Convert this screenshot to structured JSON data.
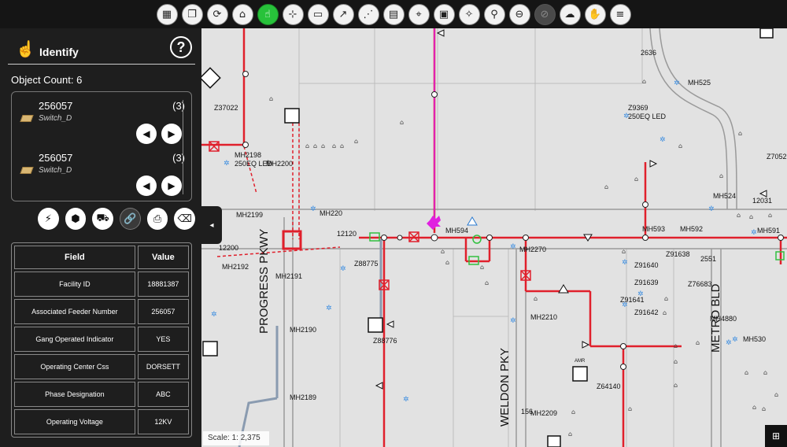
{
  "toolbar": {
    "buttons": [
      {
        "name": "map-layers-icon",
        "glyph": "▦"
      },
      {
        "name": "window-icon",
        "glyph": "❐"
      },
      {
        "name": "layers-refresh-icon",
        "glyph": "⟳"
      },
      {
        "name": "home-icon",
        "glyph": "⌂"
      },
      {
        "name": "identify-hand-icon",
        "glyph": "☝"
      },
      {
        "name": "select-features-icon",
        "glyph": "⊹"
      },
      {
        "name": "measure-icon",
        "glyph": "▭"
      },
      {
        "name": "trace-icon",
        "glyph": "↗"
      },
      {
        "name": "network-icon",
        "glyph": "⋰"
      },
      {
        "name": "book-icon",
        "glyph": "▤"
      },
      {
        "name": "coordinates-icon",
        "glyph": "⌖"
      },
      {
        "name": "print-icon",
        "glyph": "▣"
      },
      {
        "name": "compass-icon",
        "glyph": "✧"
      },
      {
        "name": "search-icon",
        "glyph": "⚲"
      },
      {
        "name": "zoom-out-icon",
        "glyph": "⊖"
      },
      {
        "name": "zoom-disabled-icon",
        "glyph": "⊘"
      },
      {
        "name": "cloud-download-icon",
        "glyph": "☁"
      },
      {
        "name": "pan-hand-icon",
        "glyph": "✋"
      },
      {
        "name": "menu-icon",
        "glyph": "≡"
      }
    ]
  },
  "panel": {
    "title": "Identify",
    "help": "?",
    "object_count": "Object Count: 6",
    "objects": [
      {
        "id": "256057",
        "type": "Switch_D",
        "count": "(3)"
      },
      {
        "id": "256057",
        "type": "Switch_D",
        "count": "(3)"
      }
    ],
    "actions": [
      {
        "name": "flash-icon",
        "glyph": "⚡"
      },
      {
        "name": "zoom-to-feature-icon",
        "glyph": "⬢"
      },
      {
        "name": "vehicle-icon",
        "glyph": "⛟"
      },
      {
        "name": "link-icon",
        "glyph": "🔗"
      },
      {
        "name": "export-icon",
        "glyph": "⎙"
      },
      {
        "name": "clear-icon",
        "glyph": "⌫"
      }
    ],
    "table": {
      "col_field": "Field",
      "col_value": "Value",
      "rows": [
        {
          "field": "Facility ID",
          "value": "18881387"
        },
        {
          "field": "Associated Feeder Number",
          "value": "256057"
        },
        {
          "field": "Gang Operated Indicator",
          "value": "YES"
        },
        {
          "field": "Operating Center Css",
          "value": "DORSETT"
        },
        {
          "field": "Phase Designation",
          "value": "ABC"
        },
        {
          "field": "Operating Voltage",
          "value": "12KV"
        }
      ]
    }
  },
  "map": {
    "scale": "Scale:  1: 2,375",
    "collapse_glyph": "◂",
    "roads": [
      "PROGRESS PKWY",
      "WELDON PKY",
      "METRO BLD"
    ],
    "labels": [
      "Z37022",
      "MH2198",
      "250EQ LED",
      "MH2200",
      "MH2199",
      "MH220",
      "MH2192",
      "MH2191",
      "MH2190",
      "MH2189",
      "Z88775",
      "Z88776",
      "MH594",
      "MH2270",
      "MH2210",
      "MH2209",
      "Z64140",
      "MH593",
      "MH592",
      "MH591",
      "Z91638",
      "Z91640",
      "Z91639",
      "Z91641",
      "Z91642",
      "Z76683",
      "MH4880",
      "MH530",
      "MH525",
      "Z9369",
      "250EQ LED",
      "MH524",
      "Z7052",
      "2636",
      "12031",
      "12120",
      "12200",
      "2551",
      "156"
    ]
  },
  "colors": {
    "primary_line": "#e0202c",
    "highlight": "#e020e0",
    "active_tool": "#27c23a"
  }
}
